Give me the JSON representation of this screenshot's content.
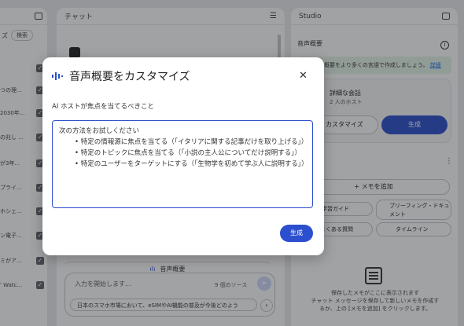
{
  "sources_panel": {
    "search_label": "ズ",
    "search_button": "検索",
    "items": [
      "つの理...",
      "2030年...",
      "の兆し ...",
      "が3年...",
      "プライ...",
      "ホシェ...",
      "ン電子...",
      "ミがア...",
      "' Watc..."
    ]
  },
  "chat_panel": {
    "title": "チャット",
    "audio_chip_label": "音声概要",
    "input_placeholder": "入力を開始します...",
    "source_count": "9 個のソース",
    "suggestion": "日本のスマホ市場において、eSIMやAI機能の普及が今後どのよう"
  },
  "studio_panel": {
    "title": "Studio",
    "audio_overview_label": "音声概要",
    "banner_text": "概要をより多くの言語で作成しましょう。",
    "banner_link": "詳細",
    "card_title": "詳細な会話",
    "card_subtitle": "2 人のホスト",
    "customize_button": "カスタマイズ",
    "generate_button": "生成",
    "add_note_button": "+ メモを追加",
    "study_guide_button": "学習ガイド",
    "briefing_button": "ブリーフィング・ドキュメント",
    "faq_button": "よくある質問",
    "timeline_button": "タイムライン",
    "saved_notes_line1": "保存したメモがここに表示されます",
    "saved_notes_line2": "チャット メッセージを保存して新しいメモを作成す",
    "saved_notes_line3": "るか、上の [メモを追加] をクリックします。"
  },
  "dialog": {
    "title": "音声概要をカスタマイズ",
    "label": "AI ホストが焦点を当てるべきこと",
    "textarea_lines": [
      "次の方法をお試しください",
      "• 特定の情報源に焦点を当てる（「イタリアに関する記事だけを取り上げる」）",
      "• 特定のトピックに焦点を当てる（「小説の主人公についてだけ説明する」）",
      "• 特定のユーザーをターゲットにする（「生物学を初めて学ぶ人に説明する」）"
    ],
    "submit_button": "生成",
    "close_icon": "close-icon"
  },
  "colors": {
    "primary": "#2b4fce",
    "scrim": "rgba(32,33,36,0.42)",
    "banner": "#e6f4ea"
  }
}
